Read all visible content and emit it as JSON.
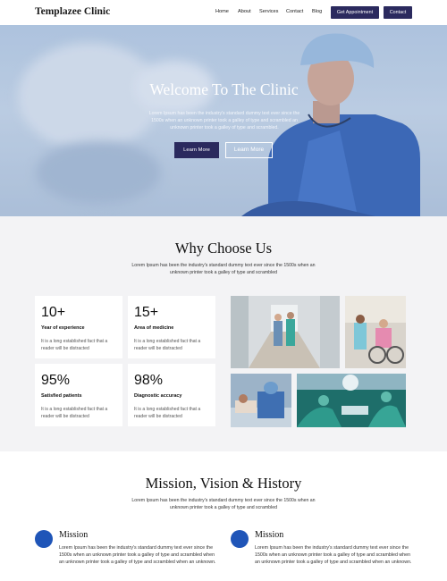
{
  "header": {
    "logo": "Templazee Clinic",
    "nav": [
      "Home",
      "About",
      "Services",
      "Contact",
      "Blog"
    ],
    "appointment_button": "Get Appointment",
    "contact_button": "Contact"
  },
  "hero": {
    "title": "Welcome To The Clinic",
    "text": "Lorem Ipsum has been the industry's standard dummy text ever since the 1500s when an unknown printer took a galley of type and scrambled an unknown printer took a galley of type and scrambled.",
    "primary_button": "Learn More",
    "secondary_button": "Learn More"
  },
  "why": {
    "title": "Why Choose Us",
    "subtitle": "Lorem Ipsum has been the industry's standard dummy text ever since the 1500s when an unknown printer took a galley of type and scrambled",
    "stats": [
      {
        "value": "10+",
        "label": "Year of experience",
        "desc": "It is a long established fact that a reader will be distracted"
      },
      {
        "value": "15+",
        "label": "Area of medicine",
        "desc": "It is a long established fact that a reader will be distracted"
      },
      {
        "value": "95%",
        "label": "Satisfied patients",
        "desc": "It is a long established fact that a reader will be distracted"
      },
      {
        "value": "98%",
        "label": "Diagnostic accuracy",
        "desc": "It is a long established fact that a reader will be distracted"
      }
    ]
  },
  "mission": {
    "title": "Mission, Vision & History",
    "subtitle": "Lorem Ipsum has been the industry's standard dummy text ever since the 1500s when an unknown printer took a galley of type and scrambled",
    "items": [
      {
        "title": "Mission",
        "text": "Lorem Ipsum has been the industry's standard dummy text ever since the 1500s when an unknown printer took a galley of type and scrambled when an unknown printer took a galley of type and scrambled when an unknown."
      },
      {
        "title": "Mission",
        "text": "Lorem Ipsum has been the industry's standard dummy text ever since the 1500s when an unknown printer took a galley of type and scrambled when an unknown printer took a galley of type and scrambled when an unknown."
      }
    ]
  },
  "colors": {
    "brand": "#2b2a5e",
    "accent": "#1f55b8",
    "section_bg": "#f3f3f5"
  }
}
